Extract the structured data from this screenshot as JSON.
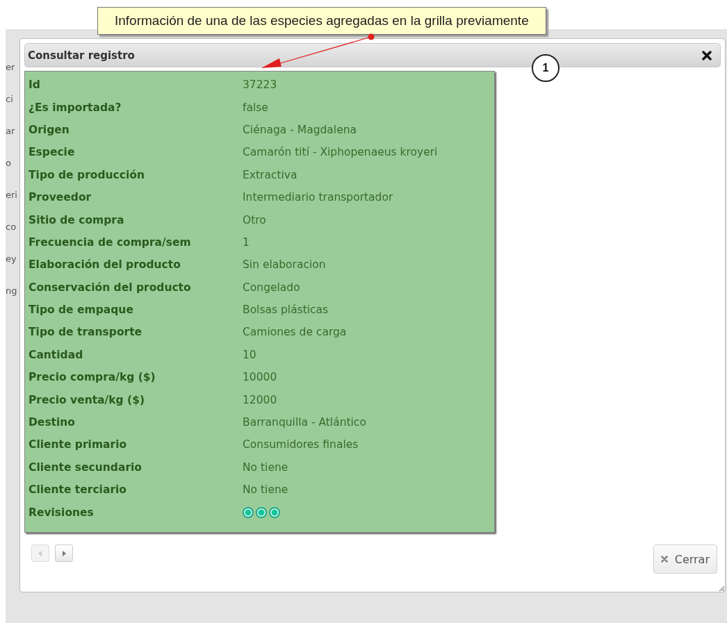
{
  "callout": {
    "text": "Información de una de las especies agregadas en la grilla previamente",
    "marker": "1"
  },
  "background_fragments": [
    "er",
    "ci",
    "ar",
    "o",
    "eri",
    "co",
    "ey",
    "ng"
  ],
  "dialog": {
    "title": "Consultar registro",
    "rows": [
      {
        "kind": "text",
        "label": "Id",
        "value": "37223"
      },
      {
        "kind": "text",
        "label": "¿Es importada?",
        "value": "false"
      },
      {
        "kind": "text",
        "label": "Origen",
        "value": "Ciénaga - Magdalena"
      },
      {
        "kind": "text",
        "label": "Especie",
        "value": "Camarón tití - Xiphopenaeus kroyeri"
      },
      {
        "kind": "text",
        "label": "Tipo de producción",
        "value": "Extractiva"
      },
      {
        "kind": "text",
        "label": "Proveedor",
        "value": "Intermediario transportador"
      },
      {
        "kind": "text",
        "label": "Sitio de compra",
        "value": "Otro"
      },
      {
        "kind": "text",
        "label": "Frecuencia de compra/sem",
        "value": "1"
      },
      {
        "kind": "text",
        "label": "Elaboración del producto",
        "value": "Sin elaboracion"
      },
      {
        "kind": "text",
        "label": "Conservación del producto",
        "value": "Congelado"
      },
      {
        "kind": "text",
        "label": "Tipo de empaque",
        "value": "Bolsas plásticas"
      },
      {
        "kind": "text",
        "label": "Tipo de transporte",
        "value": "Camiones de carga"
      },
      {
        "kind": "text",
        "label": "Cantidad",
        "value": "10"
      },
      {
        "kind": "text",
        "label": "Precio compra/kg ($)",
        "value": "10000"
      },
      {
        "kind": "text",
        "label": "Precio venta/kg ($)",
        "value": "12000"
      },
      {
        "kind": "text",
        "label": "Destino",
        "value": "Barranquilla - Atlántico"
      },
      {
        "kind": "text",
        "label": "Cliente primario",
        "value": "Consumidores finales"
      },
      {
        "kind": "text",
        "label": "Cliente secundario",
        "value": "No tiene"
      },
      {
        "kind": "text",
        "label": "Cliente terciario",
        "value": "No tiene"
      },
      {
        "kind": "dots",
        "label": "Revisiones",
        "dots": [
          {
            "checked": true
          },
          {
            "checked": true
          },
          {
            "checked": true
          }
        ]
      }
    ],
    "nav": [
      {
        "kind": "prev",
        "disabled": true
      },
      {
        "kind": "next",
        "disabled": false
      }
    ],
    "close_button": "Cerrar"
  }
}
